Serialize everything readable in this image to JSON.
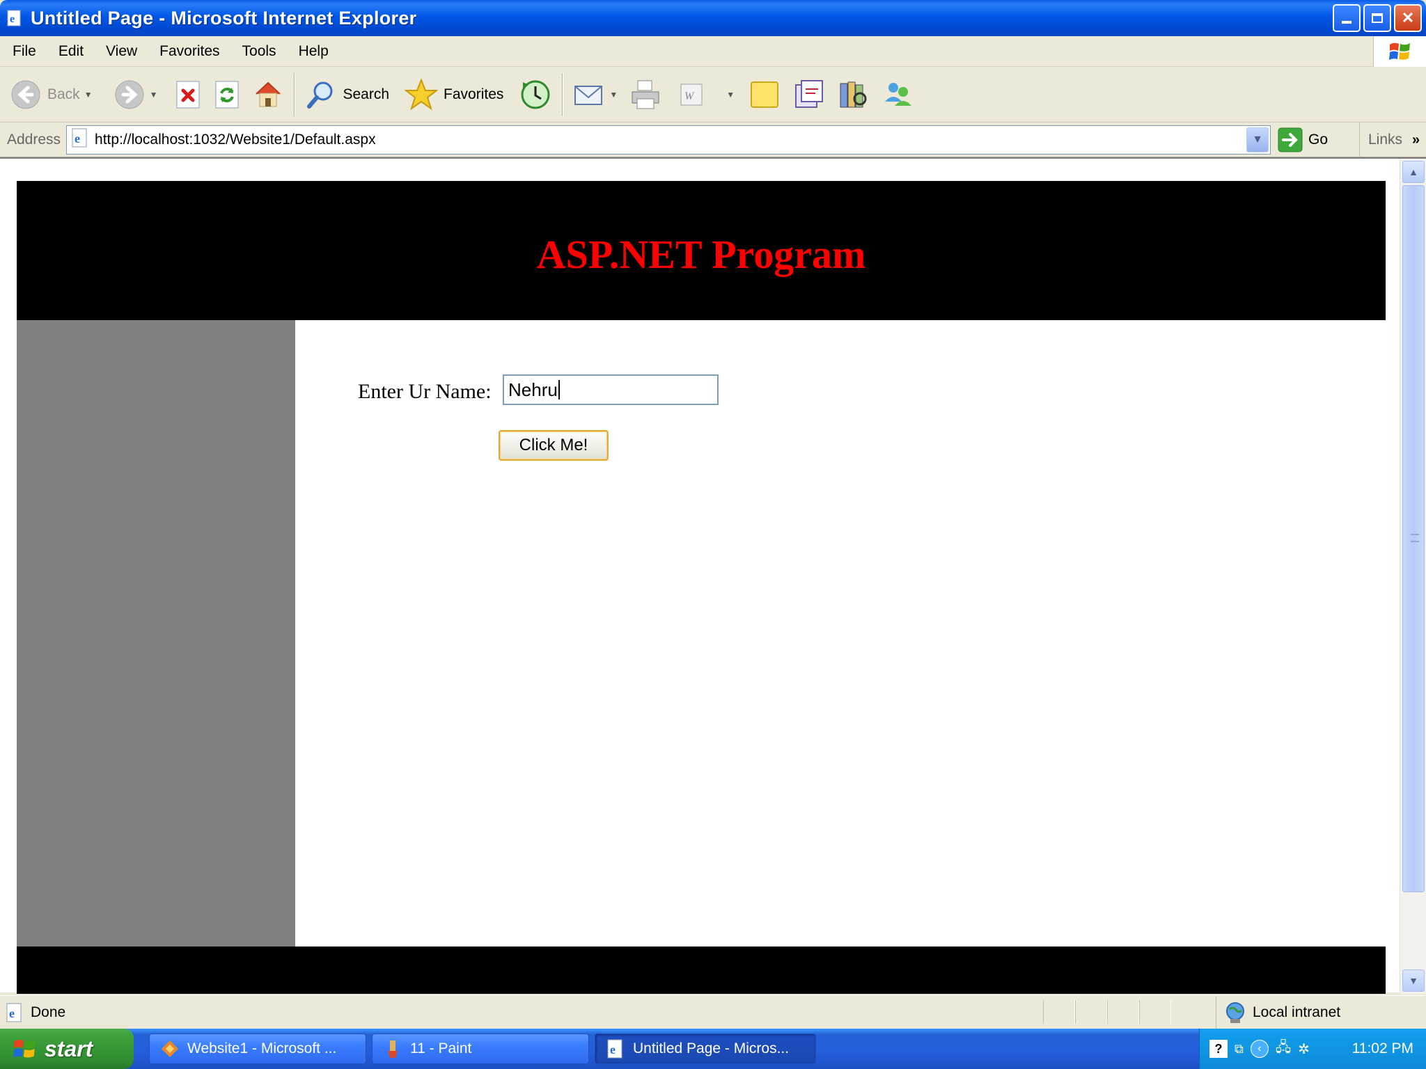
{
  "window": {
    "title": "Untitled Page - Microsoft Internet Explorer"
  },
  "menu": [
    "File",
    "Edit",
    "View",
    "Favorites",
    "Tools",
    "Help"
  ],
  "toolbar": {
    "back_label": "Back",
    "search_label": "Search",
    "favorites_label": "Favorites"
  },
  "address": {
    "label": "Address",
    "url": "http://localhost:1032/Website1/Default.aspx",
    "go_label": "Go",
    "links_label": "Links"
  },
  "page": {
    "heading": "ASP.NET Program",
    "name_label": "Enter Ur Name:",
    "name_value": "Nehru",
    "button_label": "Click Me!"
  },
  "status": {
    "text": "Done",
    "zone": "Local intranet"
  },
  "taskbar": {
    "start_label": "start",
    "tasks": [
      "Website1 - Microsoft ...",
      "11 - Paint",
      "Untitled Page - Micros..."
    ],
    "clock": "11:02 PM"
  },
  "colors": {
    "header_bg": "#000000",
    "heading_color": "#ff0000",
    "sidebar_bg": "#808080",
    "titlebar_blue": "#0058e6"
  }
}
